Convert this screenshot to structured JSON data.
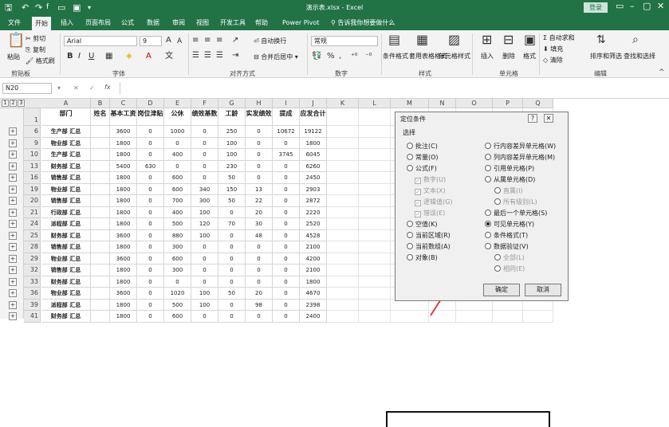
{
  "title_bar": {
    "filename": "演示表.xlsx - Excel",
    "login": "登录",
    "quick_access": [
      "save-icon",
      "undo-icon",
      "redo-icon",
      "font-icon",
      "new-icon",
      "open-icon",
      "customize-icon"
    ]
  },
  "tabs": [
    "文件",
    "开始",
    "插入",
    "页面布局",
    "公式",
    "数据",
    "审阅",
    "视图",
    "开发工具",
    "帮助",
    "Power Pivot"
  ],
  "active_tab": "开始",
  "tell_me": "告诉我你想要做什么",
  "ribbon": {
    "clipboard": {
      "paste": "粘贴",
      "cut": "剪切",
      "copy": "复制",
      "format_painter": "格式刷",
      "label": "剪贴板"
    },
    "font": {
      "name": "Arial",
      "size": "9",
      "label": "字体",
      "bold": "B",
      "italic": "I",
      "underline": "U"
    },
    "alignment": {
      "wrap": "自动换行",
      "merge": "合并后居中",
      "label": "对齐方式"
    },
    "number": {
      "format": "常规",
      "label": "数字"
    },
    "styles": {
      "conditional": "条件格式",
      "table": "套用表格格式",
      "cell": "单元格样式",
      "label": "样式"
    },
    "cells": {
      "insert": "插入",
      "delete": "删除",
      "format": "格式",
      "label": "单元格"
    },
    "editing": {
      "autosum": "自动求和",
      "fill": "填充",
      "clear": "清除",
      "sort": "排序和筛选",
      "find": "查找和选择",
      "label": "编辑"
    }
  },
  "formula_bar": {
    "name_box": "N20",
    "cancel": "✕",
    "enter": "✓",
    "fx": "fx",
    "value": ""
  },
  "sheet": {
    "outline_levels": [
      "1",
      "2",
      "3"
    ],
    "columns": [
      "A",
      "B",
      "C",
      "D",
      "E",
      "F",
      "G",
      "H",
      "I",
      "J",
      "K",
      "L",
      "M",
      "N",
      "O",
      "P",
      "Q"
    ],
    "header_row": {
      "num": "1",
      "cells": [
        "部门",
        "姓名",
        "基本工资",
        "岗位津贴",
        "公休",
        "绩效基数",
        "工龄",
        "实发绩效",
        "提成",
        "应发合计"
      ]
    },
    "rows": [
      {
        "num": "6",
        "cells": [
          "生产部 汇总",
          "",
          "3600",
          "0",
          "1000",
          "0",
          "250",
          "0",
          "10672",
          "19122"
        ]
      },
      {
        "num": "9",
        "cells": [
          "物业部 汇总",
          "",
          "1800",
          "0",
          "0",
          "0",
          "100",
          "0",
          "0",
          "1800"
        ]
      },
      {
        "num": "10",
        "cells": [
          "生产部 汇总",
          "",
          "1800",
          "0",
          "400",
          "0",
          "100",
          "0",
          "3745",
          "6045"
        ]
      },
      {
        "num": "13",
        "cells": [
          "财务部 汇总",
          "",
          "5400",
          "630",
          "0",
          "0",
          "230",
          "0",
          "0",
          "6260"
        ]
      },
      {
        "num": "16",
        "cells": [
          "销售部 汇总",
          "",
          "1800",
          "0",
          "600",
          "0",
          "50",
          "0",
          "0",
          "2450"
        ]
      },
      {
        "num": "19",
        "cells": [
          "物业部 汇总",
          "",
          "1800",
          "0",
          "600",
          "340",
          "150",
          "13",
          "0",
          "2903"
        ]
      },
      {
        "num": "20",
        "cells": [
          "销售部 汇总",
          "",
          "1800",
          "0",
          "700",
          "300",
          "50",
          "22",
          "0",
          "2872"
        ]
      },
      {
        "num": "21",
        "cells": [
          "行政部 汇总",
          "",
          "1800",
          "0",
          "400",
          "100",
          "0",
          "20",
          "0",
          "2220"
        ]
      },
      {
        "num": "24",
        "cells": [
          "派程部 汇总",
          "",
          "1800",
          "0",
          "500",
          "120",
          "70",
          "30",
          "0",
          "2520"
        ]
      },
      {
        "num": "25",
        "cells": [
          "财务部 汇总",
          "",
          "3600",
          "0",
          "880",
          "100",
          "0",
          "48",
          "0",
          "4528"
        ]
      },
      {
        "num": "28",
        "cells": [
          "销售部 汇总",
          "",
          "1800",
          "0",
          "300",
          "0",
          "0",
          "0",
          "0",
          "2100"
        ]
      },
      {
        "num": "29",
        "cells": [
          "物业部 汇总",
          "",
          "3600",
          "0",
          "600",
          "0",
          "0",
          "0",
          "0",
          "4200"
        ]
      },
      {
        "num": "32",
        "cells": [
          "销售部 汇总",
          "",
          "1800",
          "0",
          "300",
          "0",
          "0",
          "0",
          "0",
          "2100"
        ]
      },
      {
        "num": "33",
        "cells": [
          "财务部 汇总",
          "",
          "1800",
          "0",
          "0",
          "0",
          "0",
          "0",
          "0",
          "1800"
        ]
      },
      {
        "num": "36",
        "cells": [
          "物业部 汇总",
          "",
          "3600",
          "0",
          "1020",
          "100",
          "50",
          "20",
          "0",
          "4670"
        ]
      },
      {
        "num": "39",
        "cells": [
          "派程部 汇总",
          "",
          "1800",
          "0",
          "500",
          "100",
          "0",
          "98",
          "0",
          "2398"
        ]
      },
      {
        "num": "41",
        "cells": [
          "财务部 汇总",
          "",
          "1800",
          "0",
          "600",
          "0",
          "0",
          "0",
          "0",
          "2400"
        ]
      }
    ]
  },
  "dialog": {
    "title": "定位条件",
    "help": "?",
    "close": "✕",
    "section": "选择",
    "left_options": [
      {
        "label": "批注(C)",
        "type": "radio",
        "state": "off"
      },
      {
        "label": "常量(O)",
        "type": "radio",
        "state": "off"
      },
      {
        "label": "公式(F)",
        "type": "radio",
        "state": "off"
      },
      {
        "label": "数字(U)",
        "type": "check",
        "state": "disabled"
      },
      {
        "label": "文本(X)",
        "type": "check",
        "state": "disabled"
      },
      {
        "label": "逻辑值(G)",
        "type": "check",
        "state": "disabled"
      },
      {
        "label": "错误(E)",
        "type": "check",
        "state": "disabled"
      },
      {
        "label": "空值(K)",
        "type": "radio",
        "state": "off"
      },
      {
        "label": "当前区域(R)",
        "type": "radio",
        "state": "off"
      },
      {
        "label": "当前数组(A)",
        "type": "radio",
        "state": "off"
      },
      {
        "label": "对象(B)",
        "type": "radio",
        "state": "off"
      }
    ],
    "right_options": [
      {
        "label": "行内容差异单元格(W)",
        "type": "radio",
        "state": "off"
      },
      {
        "label": "列内容差异单元格(M)",
        "type": "radio",
        "state": "off"
      },
      {
        "label": "引用单元格(P)",
        "type": "radio",
        "state": "off"
      },
      {
        "label": "从属单元格(D)",
        "type": "radio",
        "state": "off"
      },
      {
        "label": "直属(I)",
        "type": "radio",
        "state": "disabled"
      },
      {
        "label": "所有级别(L)",
        "type": "radio",
        "state": "disabled"
      },
      {
        "label": "最后一个单元格(S)",
        "type": "radio",
        "state": "off"
      },
      {
        "label": "可见单元格(Y)",
        "type": "radio",
        "state": "on"
      },
      {
        "label": "条件格式(T)",
        "type": "radio",
        "state": "off"
      },
      {
        "label": "数据验证(V)",
        "type": "radio",
        "state": "off"
      },
      {
        "label": "全部(L)",
        "type": "radio",
        "state": "disabled"
      },
      {
        "label": "相同(E)",
        "type": "radio",
        "state": "disabled"
      }
    ],
    "ok": "确定",
    "cancel": "取消"
  },
  "colors": {
    "excel_green": "#217346",
    "arrow": "#e23b3b"
  }
}
